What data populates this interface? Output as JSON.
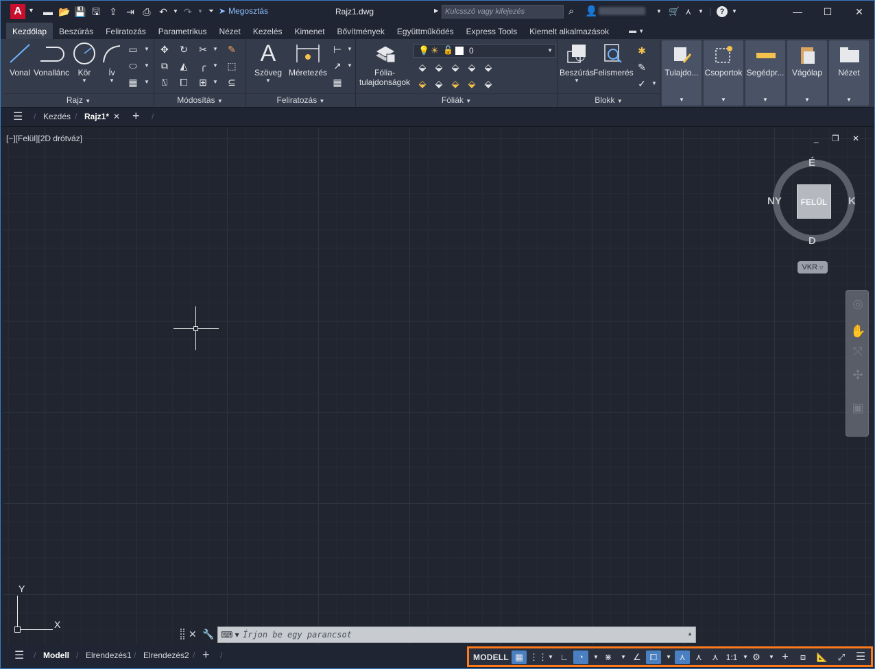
{
  "title_bar": {
    "app_logo": "A",
    "share_label": "Megosztás",
    "document_title": "Rajz1.dwg",
    "search_placeholder": "Kulcsszó vagy kifejezés",
    "user_name": "",
    "help_label": "?"
  },
  "ribbon_tabs": [
    {
      "label": "Kezdőlap",
      "active": true
    },
    {
      "label": "Beszúrás"
    },
    {
      "label": "Feliratozás"
    },
    {
      "label": "Parametrikus"
    },
    {
      "label": "Nézet"
    },
    {
      "label": "Kezelés"
    },
    {
      "label": "Kimenet"
    },
    {
      "label": "Bővítmények"
    },
    {
      "label": "Együttműködés"
    },
    {
      "label": "Express Tools"
    },
    {
      "label": "Kiemelt alkalmazások"
    }
  ],
  "ribbon": {
    "rajz": {
      "title": "Rajz",
      "tools": [
        "Vonal",
        "Vonallánc",
        "Kör",
        "Ív"
      ]
    },
    "modositas": {
      "title": "Módosítás"
    },
    "feliratozas": {
      "title": "Feliratozás",
      "tools": [
        "Szöveg",
        "Méretezés"
      ]
    },
    "foliak": {
      "title": "Fóliák",
      "tool": "Fólia-\ntulajdonságok",
      "tool_line1": "Fólia-",
      "tool_line2": "tulajdonságok",
      "layer_name": "0"
    },
    "blokk": {
      "title": "Blokk",
      "tools": [
        "Beszúrás",
        "Felismerés"
      ]
    },
    "groups": [
      "Tulajdo...",
      "Csoportok",
      "Segédpr...",
      "Vágólap",
      "Nézet"
    ]
  },
  "doc_tabs": {
    "start": "Kezdés",
    "active": "Rajz1*"
  },
  "viewport": {
    "label": "[−][Felül][2D drótváz]",
    "controls": "_ ❐ ✕"
  },
  "viewcube": {
    "face": "FELÜL",
    "north": "É",
    "south": "D",
    "east": "K",
    "west": "NY",
    "coord_system": "VKR"
  },
  "ucs": {
    "x": "X",
    "y": "Y"
  },
  "command_line": {
    "placeholder": "Írjon be egy parancsot"
  },
  "layout_tabs": [
    "Modell",
    "Elrendezés1",
    "Elrendezés2"
  ],
  "status_bar": {
    "model_label": "MODELL",
    "scale": "1:1"
  },
  "colors": {
    "accent": "#4a7fc1",
    "highlight_border": "#ff7a1a",
    "background": "#212530"
  }
}
